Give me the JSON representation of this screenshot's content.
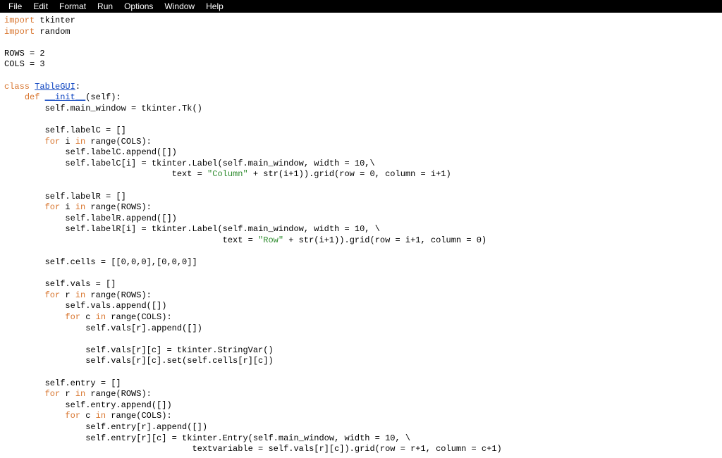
{
  "menubar": {
    "items": [
      "File",
      "Edit",
      "Format",
      "Run",
      "Options",
      "Window",
      "Help"
    ]
  },
  "code": {
    "kw_import1": "import",
    "mod_tkinter": " tkinter",
    "kw_import2": "import",
    "mod_random": " random",
    "blank": "",
    "rows_line": "ROWS = 2",
    "cols_line": "COLS = 3",
    "kw_class": "class",
    "cls_space": " ",
    "cls_name": "TableGUI",
    "cls_colon": ":",
    "indent1": "    ",
    "kw_def": "def",
    "def_space": " ",
    "fn_init": "__init__",
    "fn_sig": "(self):",
    "indent2": "        ",
    "l_mainwin": "self.main_window = tkinter.Tk()",
    "l_labelc": "self.labelC = []",
    "kw_for1": "for",
    "for1_a": " i ",
    "kw_in1": "in",
    "for1_b": " range(COLS):",
    "indent3": "            ",
    "l_labelc_app": "self.labelC.append([])",
    "l_labelc_i": "self.labelC[i] = tkinter.Label(self.main_window, width = 10,\\",
    "indent_text1": "                                 text = ",
    "str_col": "\"Column\"",
    "l_col_rest": " + str(i+1)).grid(row = 0, column = i+1)",
    "l_labelr": "self.labelR = []",
    "kw_for2": "for",
    "for2_a": " i ",
    "kw_in2": "in",
    "for2_b": " range(ROWS):",
    "l_labelr_app": "self.labelR.append([])",
    "l_labelr_i": "self.labelR[i] = tkinter.Label(self.main_window, width = 10, \\",
    "indent_text2": "                                           text = ",
    "str_row": "\"Row\"",
    "l_row_rest": " + str(i+1)).grid(row = i+1, column = 0)",
    "l_cells": "self.cells = [[0,0,0],[0,0,0]]",
    "l_vals": "self.vals = []",
    "kw_for3": "for",
    "for3_a": " r ",
    "kw_in3": "in",
    "for3_b": " range(ROWS):",
    "l_vals_app": "self.vals.append([])",
    "kw_for4": "for",
    "for4_a": " c ",
    "kw_in4": "in",
    "for4_b": " range(COLS):",
    "indent4": "                ",
    "l_vals_rc_app": "self.vals[r].append([])",
    "l_vals_rc": "self.vals[r][c] = tkinter.StringVar()",
    "l_vals_set": "self.vals[r][c].set(self.cells[r][c])",
    "l_entry": "self.entry = []",
    "kw_for5": "for",
    "for5_a": " r ",
    "kw_in5": "in",
    "for5_b": " range(ROWS):",
    "l_entry_app": "self.entry.append([])",
    "kw_for6": "for",
    "for6_a": " c ",
    "kw_in6": "in",
    "for6_b": " range(COLS):",
    "l_entry_rc_app": "self.entry[r].append([])",
    "l_entry_rc": "self.entry[r][c] = tkinter.Entry(self.main_window, width = 10, \\",
    "indent_text3": "                                     textvariable = self.vals[r][c]).grid(row = r+1, column = c+1)"
  }
}
